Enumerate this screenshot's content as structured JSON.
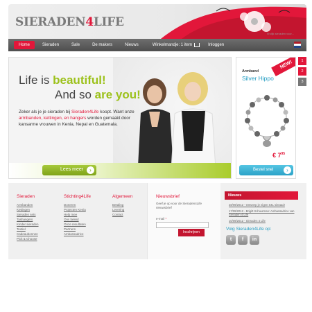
{
  "header": {
    "logo_main": "SIERADEN",
    "logo_four": "4",
    "logo_life": "LIFE",
    "tagline": "Vrolijk sieraden voor..."
  },
  "nav": {
    "items": [
      "Home",
      "Sieraden",
      "Sale",
      "De makers",
      "Nieuws"
    ],
    "cart": "Winkelmandje: 1 item",
    "login": "Inloggen"
  },
  "hero": {
    "line1_prefix": "Life is ",
    "line1_highlight": "beautiful!",
    "line2_prefix": "And so ",
    "line2_highlight": "are you!",
    "body_1": "Zeker als je je sieraden bij ",
    "body_brand": "Sieraden4Life",
    "body_2": " koopt. Want onze ",
    "body_items": "armbanden, kettingen,",
    "body_3": " ",
    "body_hangers": "en hangers",
    "body_4": " worden gemaakt door kansarme vrouwen in Kenia, Nepal en Guatemala.",
    "button": "Lees meer"
  },
  "product": {
    "badge": "NEW!",
    "category": "Armband",
    "name": "Silver Hippo",
    "price": "€ 7",
    "price_cents": "95",
    "button": "Bestel snel"
  },
  "pager": [
    "1",
    "2",
    "3"
  ],
  "footer": {
    "sieraden": {
      "title": "Sieraden",
      "links": [
        "Armbanden",
        "Kettingen",
        "Sieraden sets",
        "Tashangers",
        "Kinder sieraden",
        "Textiel",
        "Cadeaubonnen",
        "Pick & Choose"
      ]
    },
    "stichting": {
      "title": "Stichting4Life",
      "links": [
        "Doneren",
        "Projecten Kenia",
        "Help mee",
        "Ons beleid",
        "Onze resultaten",
        "Partners",
        "Ambassadrice"
      ]
    },
    "algemeen": {
      "title": "Algemeen",
      "links": [
        "Betaling",
        "Levering",
        "Contact"
      ]
    },
    "newsletter": {
      "title": "Nieuwsbrief",
      "text": "Geef je op voor de Sieraden4Life nieuwsbrief",
      "email_label": "e-mail",
      "required": "*",
      "button": "Inschrijven"
    },
    "news": {
      "title": "Nieuws",
      "items": [
        "28/09/2012 - Ontwerp je eigen S4L sieraad!",
        "17/09/2012 - Brigitt Schuurman: Ambassadrice van Sieraden 4 Life",
        "10/09/2012 - Sieraden 4 Life"
      ],
      "follow": "Volg Sieraden4Life op:",
      "social": [
        "t",
        "f",
        "in"
      ]
    }
  },
  "colors": {
    "accent": "#e2173a",
    "green": "#9cc11a",
    "blue": "#1f9bc1"
  }
}
